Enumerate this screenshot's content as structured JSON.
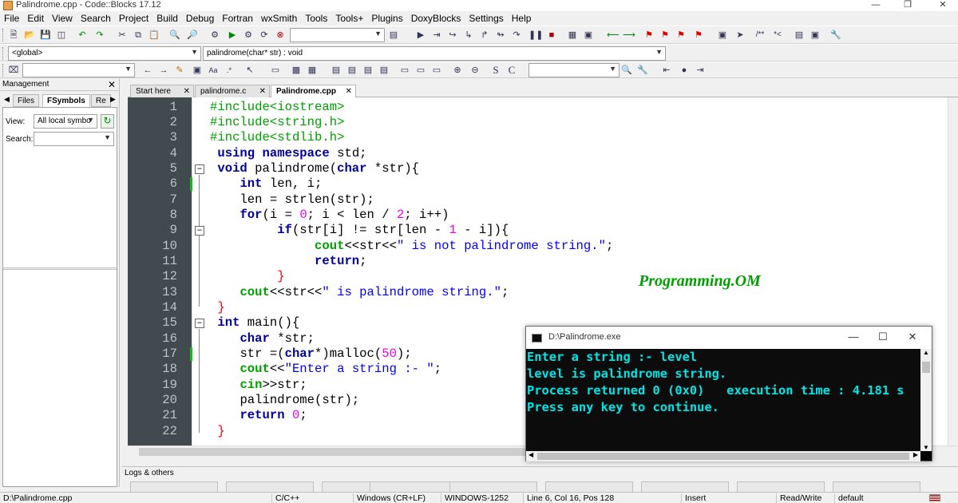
{
  "window": {
    "title": "Palindrome.cpp - Code::Blocks 17.12"
  },
  "menu": [
    "File",
    "Edit",
    "View",
    "Search",
    "Project",
    "Build",
    "Debug",
    "Fortran",
    "wxSmith",
    "Tools",
    "Tools+",
    "Plugins",
    "DoxyBlocks",
    "Settings",
    "Help"
  ],
  "toolbar": {
    "scope": "<global>",
    "function": "palindrome(char* str) : void"
  },
  "management": {
    "title": "Management",
    "tabs": [
      "Files",
      "FSymbols",
      "Re"
    ],
    "active_tab": "FSymbols",
    "view_label": "View:",
    "view_value": "All local symbo",
    "search_label": "Search:"
  },
  "editor": {
    "tabs": [
      "Start here",
      "palindrome.c",
      "Palindrome.cpp"
    ],
    "active_tab": "Palindrome.cpp",
    "line_numbers": [
      "1",
      "2",
      "3",
      "4",
      "5",
      "6",
      "7",
      "8",
      "9",
      "10",
      "11",
      "12",
      "13",
      "14",
      "15",
      "16",
      "17",
      "18",
      "19",
      "20",
      "21",
      "22"
    ],
    "code": {
      "l1a": "#include",
      "l1b": "<iostream>",
      "l2a": "#include",
      "l2b": "<string.h>",
      "l3a": "#include",
      "l3b": "<stdlib.h>",
      "l4a": "using",
      "l4b": "namespace",
      "l4c": "std;",
      "l5a": "void",
      "l5b": "palindrome(",
      "l5c": "char",
      "l5d": "*str){",
      "l6a": "int",
      "l6b": "len, i;",
      "l7a": "len = strlen(str);",
      "l8a": "for",
      "l8b": "(i = ",
      "l8c": "0",
      "l8d": "; i < len / ",
      "l8e": "2",
      "l8f": "; i++)",
      "l9a": "if",
      "l9b": "(str[i] != str[len - ",
      "l9c": "1",
      "l9d": " - i]){",
      "l10a": "cout",
      "l10b": "<<str<<",
      "l10c": "\" is not palindrome string.\"",
      "l10d": ";",
      "l11a": "return",
      "l11b": ";",
      "l12a": "}",
      "l13a": "cout",
      "l13b": "<<str<<",
      "l13c": "\" is palindrome string.\"",
      "l13d": ";",
      "l14a": "}",
      "l15a": "int",
      "l15b": "main(){",
      "l16a": "char",
      "l16b": "*str;",
      "l17a": "str =(",
      "l17b": "char",
      "l17c": "*)malloc(",
      "l17d": "50",
      "l17e": ");",
      "l18a": "cout",
      "l18b": "<<",
      "l18c": "\"Enter a string :- \"",
      "l18d": ";",
      "l19a": "cin",
      "l19b": ">>str;",
      "l20a": "palindrome(str);",
      "l21a": "return",
      "l21b": "0",
      "l21c": ";",
      "l22a": "}"
    },
    "watermark": "Programming.OM"
  },
  "console": {
    "title": "D:\\Palindrome.exe",
    "lines": [
      "Enter a string :- level",
      "level is palindrome string.",
      "Process returned 0 (0x0)   execution time : 4.181 s",
      "Press any key to continue."
    ]
  },
  "logs": {
    "title": "Logs & others"
  },
  "statusbar": {
    "file": "D:\\Palindrome.cpp",
    "language": "C/C++",
    "line_endings": "Windows (CR+LF)",
    "encoding": "WINDOWS-1252",
    "position": "Line 6, Col 16, Pos 128",
    "mode": "Insert",
    "access": "Read/Write",
    "profile": "default"
  }
}
